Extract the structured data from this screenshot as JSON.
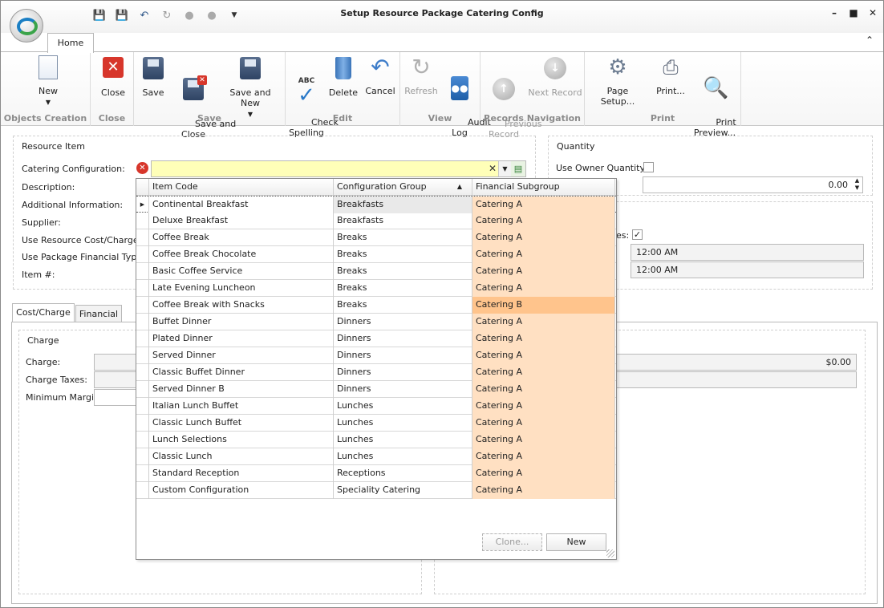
{
  "window": {
    "title": "Setup Resource Package Catering Config"
  },
  "qat": [
    "save-icon",
    "save-close-icon",
    "undo-icon",
    "redo-icon",
    "up-icon",
    "down-icon",
    "customize-icon"
  ],
  "ribbon": {
    "tab": "Home",
    "buttons": {
      "new": "New",
      "close": "Close",
      "save": "Save",
      "save_close": "Save and\nClose",
      "save_new": "Save and New",
      "check_spelling": "Check\nSpelling",
      "delete": "Delete",
      "cancel": "Cancel",
      "refresh": "Refresh",
      "audit_log": "Audit\nLog",
      "previous_record": "Previous\nRecord",
      "next_record": "Next Record",
      "page_setup": "Page Setup...",
      "print": "Print...",
      "print_preview": "Print\nPreview..."
    },
    "groups": {
      "objects_creation": "Objects Creation",
      "close": "Close",
      "save": "Save",
      "edit": "Edit",
      "view": "View",
      "records_navigation": "Records Navigation",
      "print": "Print"
    },
    "abc_label": "ABC"
  },
  "resource_item": {
    "legend": "Resource Item",
    "labels": {
      "catering": "Catering Configuration:",
      "description": "Description:",
      "additional": "Additional Information:",
      "supplier": "Supplier:",
      "use_resource_cost": "Use Resource Cost/Charge:",
      "use_package_financial": "Use Package Financial Type:",
      "item_no": "Item #:"
    },
    "catering_value": ""
  },
  "quantity": {
    "legend": "Quantity",
    "use_owner_label": "Use Owner Quantity:",
    "quantity_value": "0.00",
    "partial_label": "es:",
    "time1": "12:00 AM",
    "time2": "12:00 AM"
  },
  "subtabs": {
    "cost": "Cost/Charge",
    "financial": "Financial"
  },
  "charge": {
    "legend": "Charge",
    "labels": {
      "charge": "Charge:",
      "charge_taxes": "Charge Taxes:",
      "minimum_margin": "Minimum Margin:"
    },
    "amount": "$0.00"
  },
  "grid": {
    "columns": [
      "Item Code",
      "Configuration Group",
      "Financial Subgroup"
    ],
    "rows": [
      [
        "Continental Breakfast",
        "Breakfasts",
        "Catering A"
      ],
      [
        "Deluxe Breakfast",
        "Breakfasts",
        "Catering A"
      ],
      [
        "Coffee Break",
        "Breaks",
        "Catering A"
      ],
      [
        "Coffee Break Chocolate",
        "Breaks",
        "Catering A"
      ],
      [
        "Basic Coffee Service",
        "Breaks",
        "Catering A"
      ],
      [
        "Late Evening Luncheon",
        "Breaks",
        "Catering A"
      ],
      [
        "Coffee Break with Snacks",
        "Breaks",
        "Catering B"
      ],
      [
        "Buffet Dinner",
        "Dinners",
        "Catering A"
      ],
      [
        "Plated Dinner",
        "Dinners",
        "Catering A"
      ],
      [
        "Served Dinner",
        "Dinners",
        "Catering A"
      ],
      [
        "Classic Buffet Dinner",
        "Dinners",
        "Catering A"
      ],
      [
        "Served Dinner B",
        "Dinners",
        "Catering A"
      ],
      [
        "Italian Lunch Buffet",
        "Lunches",
        "Catering A"
      ],
      [
        "Classic Lunch Buffet",
        "Lunches",
        "Catering A"
      ],
      [
        "Lunch Selections",
        "Lunches",
        "Catering A"
      ],
      [
        "Classic Lunch",
        "Lunches",
        "Catering A"
      ],
      [
        "Standard Reception",
        "Receptions",
        "Catering A"
      ],
      [
        "Custom Configuration",
        "Speciality Catering",
        "Catering A"
      ]
    ],
    "clone_label": "Clone...",
    "new_label": "New"
  }
}
